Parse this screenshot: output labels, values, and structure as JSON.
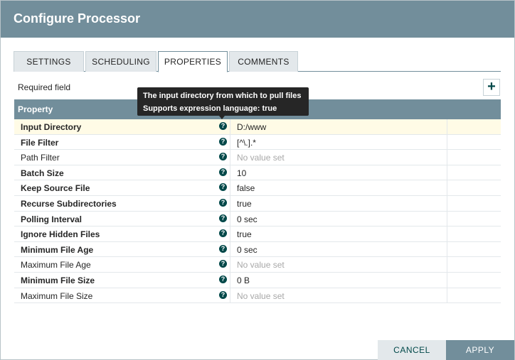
{
  "dialog": {
    "title": "Configure Processor"
  },
  "tabs": [
    {
      "label": "SETTINGS"
    },
    {
      "label": "SCHEDULING"
    },
    {
      "label": "PROPERTIES"
    },
    {
      "label": "COMMENTS"
    }
  ],
  "active_tab": "PROPERTIES",
  "required_label": "Required field",
  "add_property_glyph": "+",
  "table": {
    "header": "Property",
    "rows": [
      {
        "name": "Input Directory",
        "value": "D:/www",
        "required": true,
        "has_value": true
      },
      {
        "name": "File Filter",
        "value": "[^\\.].*",
        "required": true,
        "has_value": true
      },
      {
        "name": "Path Filter",
        "value": "No value set",
        "required": false,
        "has_value": false
      },
      {
        "name": "Batch Size",
        "value": "10",
        "required": true,
        "has_value": true
      },
      {
        "name": "Keep Source File",
        "value": "false",
        "required": true,
        "has_value": true
      },
      {
        "name": "Recurse Subdirectories",
        "value": "true",
        "required": true,
        "has_value": true
      },
      {
        "name": "Polling Interval",
        "value": "0 sec",
        "required": true,
        "has_value": true
      },
      {
        "name": "Ignore Hidden Files",
        "value": "true",
        "required": true,
        "has_value": true
      },
      {
        "name": "Minimum File Age",
        "value": "0 sec",
        "required": true,
        "has_value": true
      },
      {
        "name": "Maximum File Age",
        "value": "No value set",
        "required": false,
        "has_value": false
      },
      {
        "name": "Minimum File Size",
        "value": "0 B",
        "required": true,
        "has_value": true
      },
      {
        "name": "Maximum File Size",
        "value": "No value set",
        "required": false,
        "has_value": false
      }
    ]
  },
  "tooltip": {
    "line1": "The input directory from which to pull files",
    "line2": "Supports expression language: true"
  },
  "buttons": {
    "cancel": "CANCEL",
    "apply": "APPLY"
  },
  "colors": {
    "header": "#728e9b",
    "accent": "#004849",
    "highlight_row": "#fffbe6",
    "tooltip_bg": "#262626"
  },
  "icons": {
    "help": "question-circle-icon",
    "add": "plus-icon"
  }
}
